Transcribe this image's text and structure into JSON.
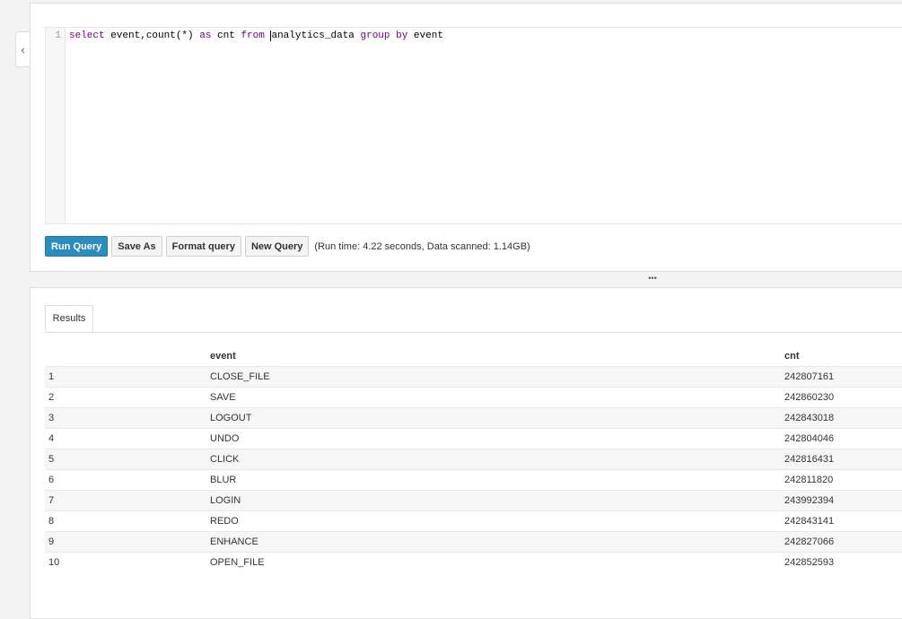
{
  "sidebar_toggle": {
    "icon": "chevron-left-icon",
    "glyph": "‹"
  },
  "editor": {
    "line_numbers": [
      "1"
    ],
    "query_tokens": [
      {
        "text": "select",
        "kw": true
      },
      {
        "text": " event,count(*) ",
        "kw": false
      },
      {
        "text": "as",
        "kw": true
      },
      {
        "text": " cnt ",
        "kw": false
      },
      {
        "text": "from",
        "kw": true
      },
      {
        "text": " ",
        "kw": false
      },
      {
        "text": "analytics_data",
        "kw": false,
        "cursor": true
      },
      {
        "text": " ",
        "kw": false
      },
      {
        "text": "group",
        "kw": true
      },
      {
        "text": " ",
        "kw": false
      },
      {
        "text": "by",
        "kw": true
      },
      {
        "text": " event",
        "kw": false
      }
    ]
  },
  "toolbar": {
    "run_label": "Run Query",
    "save_as_label": "Save As",
    "format_label": "Format query",
    "new_label": "New Query",
    "run_info": "(Run time: 4.22 seconds, Data scanned: 1.14GB)"
  },
  "splitter": {
    "glyph": "•••"
  },
  "results": {
    "tab_label": "Results",
    "columns": [
      "",
      "event",
      "cnt"
    ],
    "rows": [
      [
        "1",
        "CLOSE_FILE",
        "242807161"
      ],
      [
        "2",
        "SAVE",
        "242860230"
      ],
      [
        "3",
        "LOGOUT",
        "242843018"
      ],
      [
        "4",
        "UNDO",
        "242804046"
      ],
      [
        "5",
        "CLICK",
        "242816431"
      ],
      [
        "6",
        "BLUR",
        "242811820"
      ],
      [
        "7",
        "LOGIN",
        "243992394"
      ],
      [
        "8",
        "REDO",
        "242843141"
      ],
      [
        "9",
        "ENHANCE",
        "242827066"
      ],
      [
        "10",
        "OPEN_FILE",
        "242852593"
      ]
    ]
  },
  "colors": {
    "primary": "#2b8dbd",
    "keyword": "#770088"
  }
}
